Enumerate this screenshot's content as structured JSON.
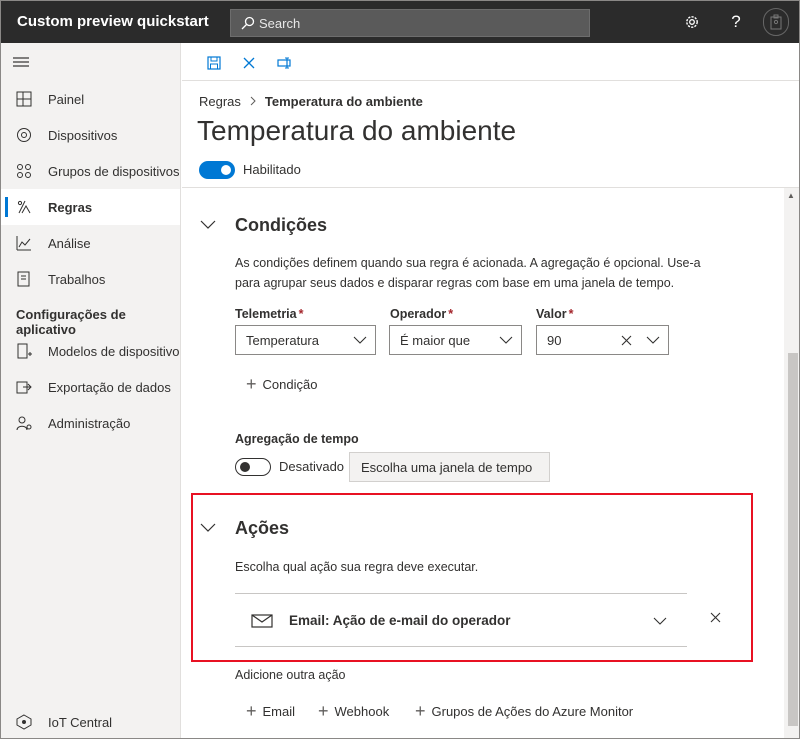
{
  "app": {
    "title": "Custom preview quickstart"
  },
  "search": {
    "placeholder": "Search"
  },
  "sidebar": {
    "items": [
      {
        "label": "Painel",
        "icon": "dashboard-icon"
      },
      {
        "label": "Dispositivos",
        "icon": "devices-icon"
      },
      {
        "label": "Grupos de dispositivos",
        "icon": "device-groups-icon"
      },
      {
        "label": "Regras",
        "icon": "rules-icon",
        "active": true
      },
      {
        "label": "Análise",
        "icon": "analytics-icon"
      },
      {
        "label": "Trabalhos",
        "icon": "jobs-icon"
      }
    ],
    "section_title": "Configurações de aplicativo",
    "config_items": [
      {
        "label": "Modelos de dispositivo",
        "icon": "device-templates-icon"
      },
      {
        "label": "Exportação de dados",
        "icon": "data-export-icon"
      },
      {
        "label": "Administração",
        "icon": "administration-icon"
      }
    ],
    "footer_label": "IoT Central"
  },
  "breadcrumb": {
    "parent": "Regras",
    "current": "Temperatura do ambiente"
  },
  "page": {
    "title": "Temperatura do ambiente",
    "enabled_label": "Habilitado"
  },
  "conditions": {
    "title": "Condições",
    "description": "As condições definem quando sua regra é acionada. A agregação é opcional. Use-a para agrupar seus dados e disparar regras com base em uma janela de tempo.",
    "telemetry_label": "Telemetria",
    "telemetry_value": "Temperatura",
    "operator_label": "Operador",
    "operator_value": "É maior que",
    "value_label": "Valor",
    "value_value": "90",
    "required_mark": "*",
    "add_condition": "Condição",
    "aggregation_label": "Agregação de tempo",
    "aggregation_state": "Desativado",
    "time_window_button": "Escolha uma janela de tempo"
  },
  "actions": {
    "title": "Ações",
    "description": "Escolha qual ação sua regra deve executar.",
    "action_item": "Email: Ação de e-mail do operador",
    "add_another": "Adicione outra ação",
    "add_email": "Email",
    "add_webhook": "Webhook",
    "add_azure_monitor": "Grupos de Ações do Azure Monitor"
  },
  "colors": {
    "accent": "#0078d4",
    "topbar": "#2b2b2b",
    "highlight": "#e81123"
  }
}
